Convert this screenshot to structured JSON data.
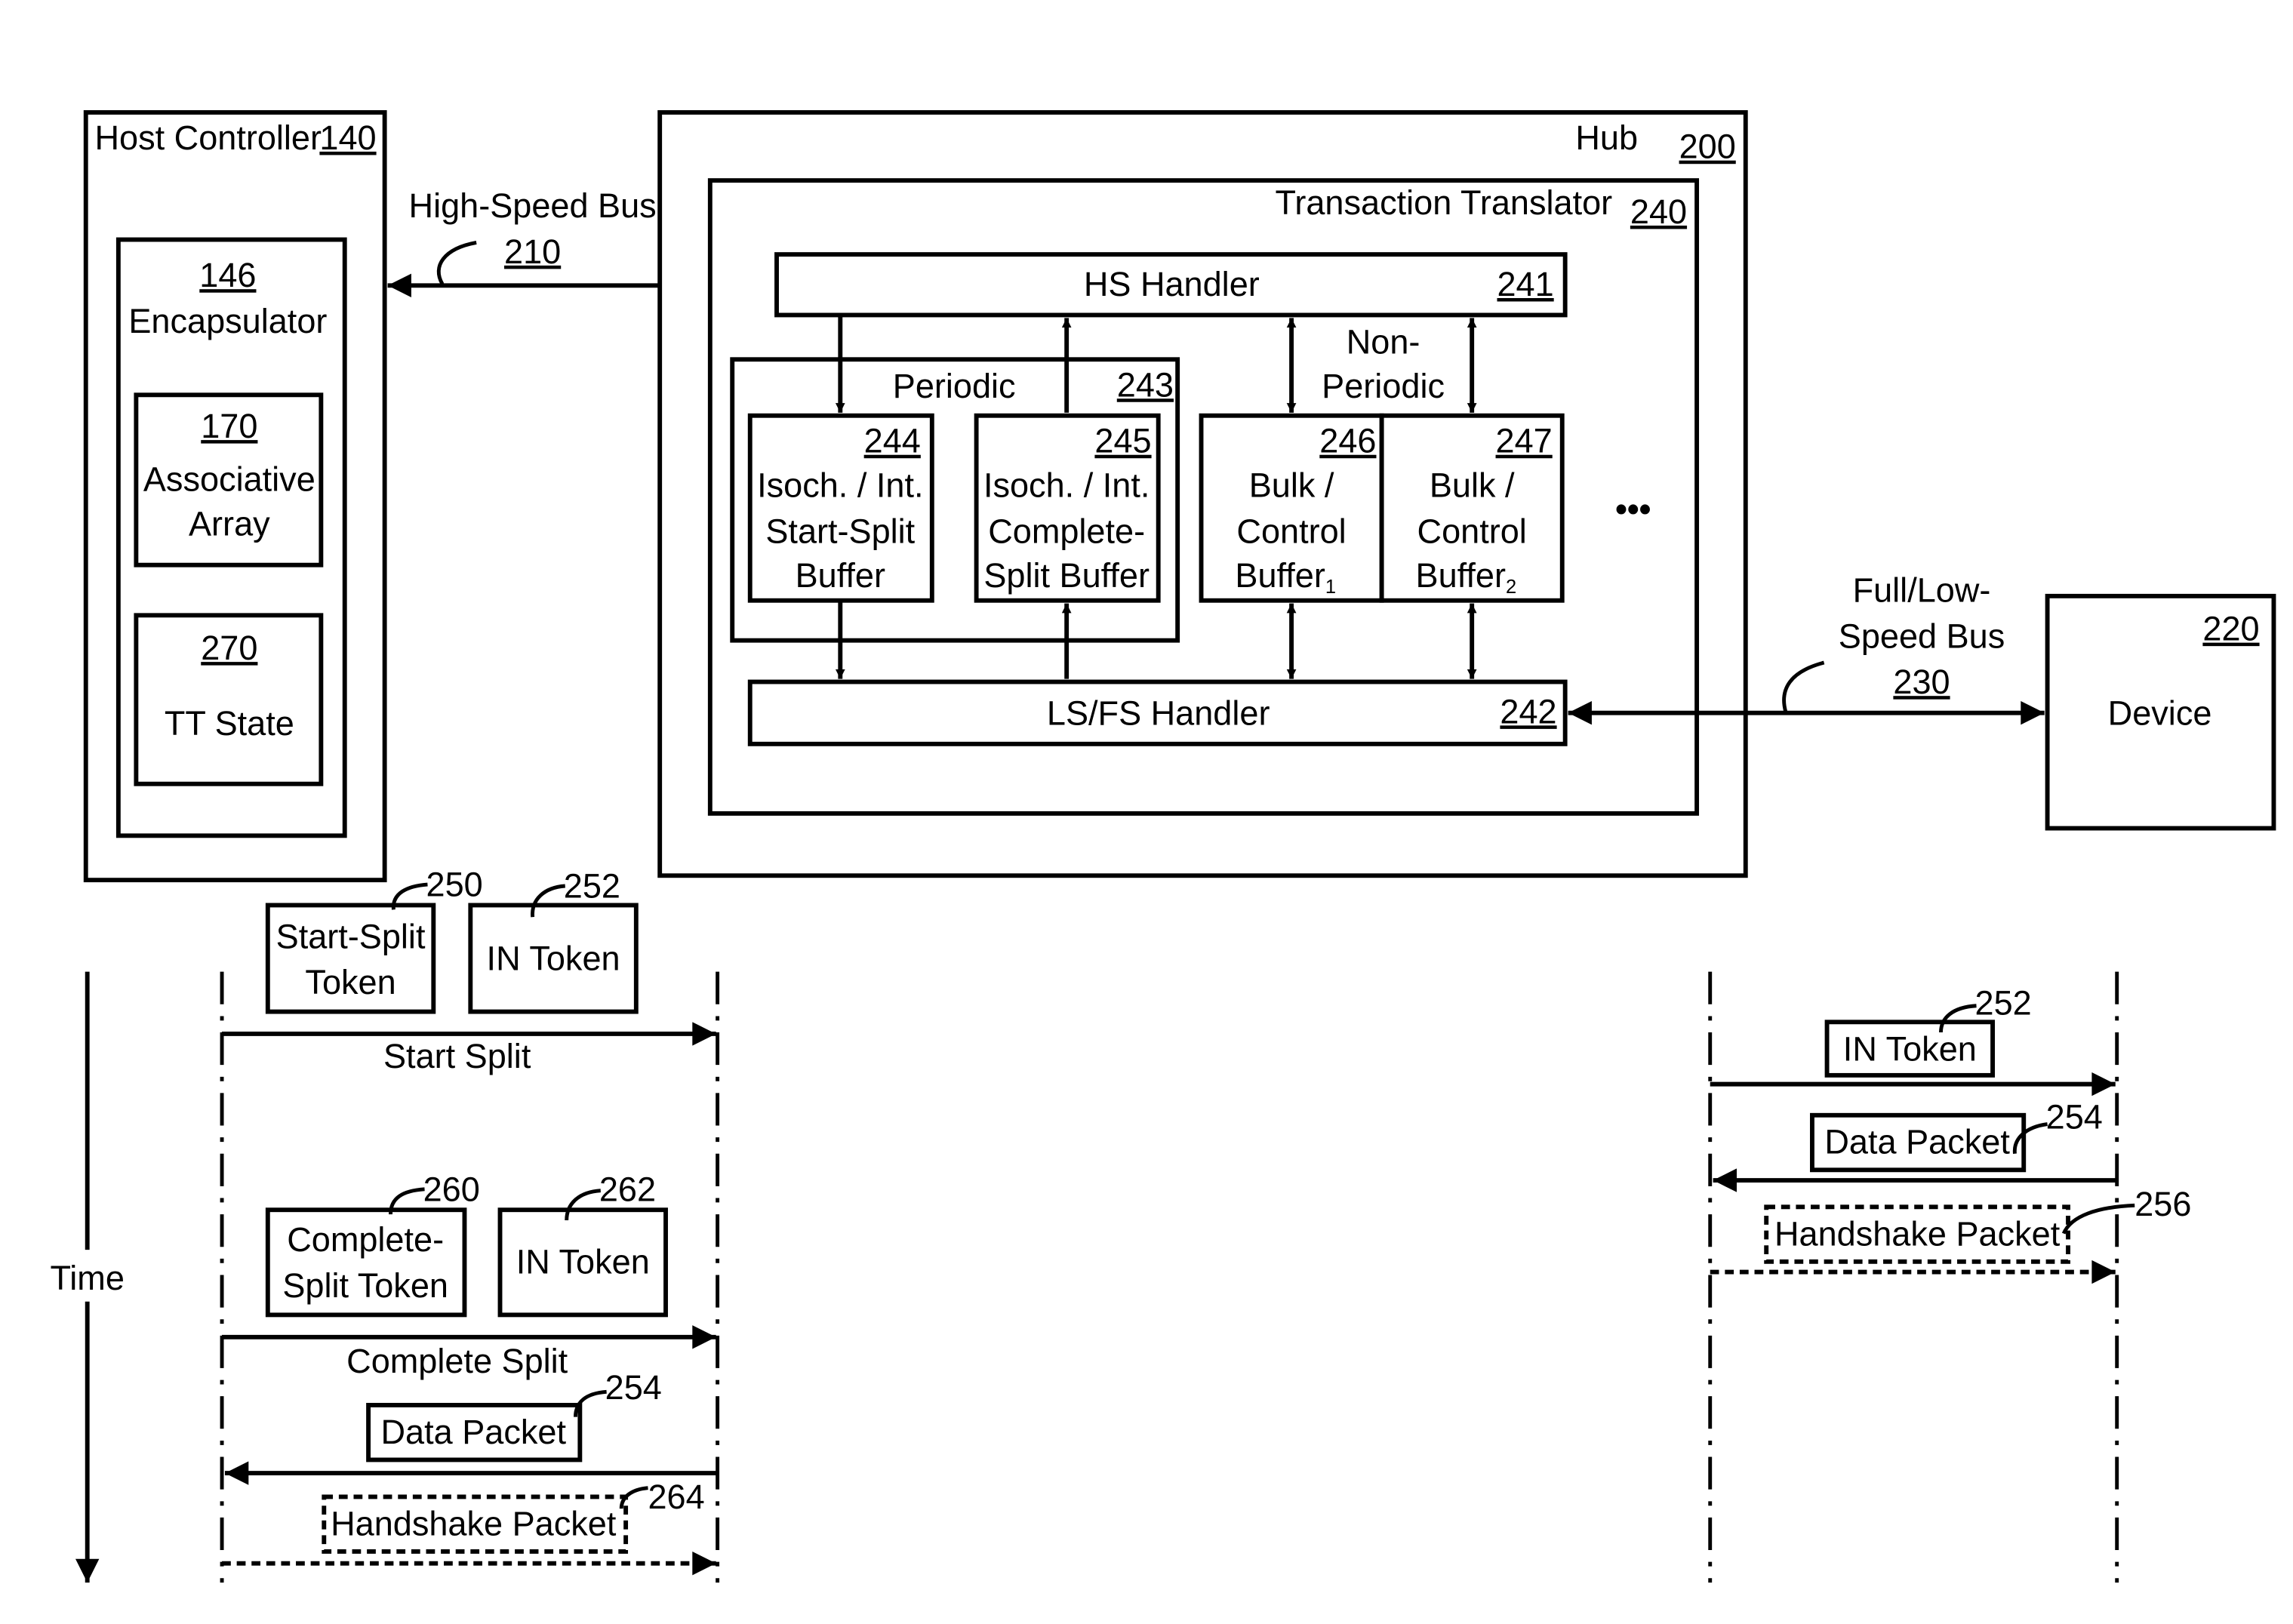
{
  "host_controller": {
    "label": "Host Controller",
    "ref": "140",
    "encapsulator": {
      "ref": "146",
      "label": "Encapsulator"
    },
    "associative_array": {
      "ref": "170",
      "line1": "Associative",
      "line2": "Array"
    },
    "tt_state": {
      "ref": "270",
      "label": "TT State"
    }
  },
  "high_speed_bus": {
    "label": "High-Speed Bus",
    "ref": "210"
  },
  "hub": {
    "label": "Hub",
    "ref": "200",
    "transaction_translator": {
      "label": "Transaction Translator",
      "ref": "240",
      "hs_handler": {
        "label": "HS Handler",
        "ref": "241"
      },
      "lsfs_handler": {
        "label": "LS/FS Handler",
        "ref": "242"
      },
      "periodic": {
        "label": "Periodic",
        "ref": "243",
        "start_split_buffer": {
          "ref": "244",
          "line1": "Isoch. / Int.",
          "line2": "Start-Split",
          "line3": "Buffer"
        },
        "complete_split_buffer": {
          "ref": "245",
          "line1": "Isoch. / Int.",
          "line2": "Complete-",
          "line3": "Split Buffer"
        }
      },
      "non_periodic": {
        "line1": "Non-",
        "line2": "Periodic",
        "buffer1": {
          "ref": "246",
          "line1": "Bulk /",
          "line2": "Control",
          "line3": "Buffer",
          "sub": "1"
        },
        "buffer2": {
          "ref": "247",
          "line1": "Bulk /",
          "line2": "Control",
          "line3": "Buffer",
          "sub": "2"
        }
      },
      "ellipsis": "•••"
    }
  },
  "full_low_speed_bus": {
    "line1": "Full/Low-",
    "line2": "Speed Bus",
    "ref": "230"
  },
  "device": {
    "label": "Device",
    "ref": "220"
  },
  "time_axis": {
    "label": "Time"
  },
  "hs_sequence": {
    "start_split_token": {
      "line1": "Start-Split",
      "line2": "Token",
      "ref": "250"
    },
    "in_token_1": {
      "label": "IN Token",
      "ref": "252"
    },
    "start_split_label": "Start Split",
    "complete_split_token": {
      "line1": "Complete-",
      "line2": "Split Token",
      "ref": "260"
    },
    "in_token_2": {
      "label": "IN Token",
      "ref": "262"
    },
    "complete_split_label": "Complete Split",
    "data_packet": {
      "label": "Data Packet",
      "ref": "254"
    },
    "handshake_packet": {
      "label": "Handshake Packet",
      "ref": "264"
    }
  },
  "fs_sequence": {
    "in_token": {
      "label": "IN Token",
      "ref": "252"
    },
    "data_packet": {
      "label": "Data Packet",
      "ref": "254"
    },
    "handshake_packet": {
      "label": "Handshake Packet",
      "ref": "256"
    }
  }
}
